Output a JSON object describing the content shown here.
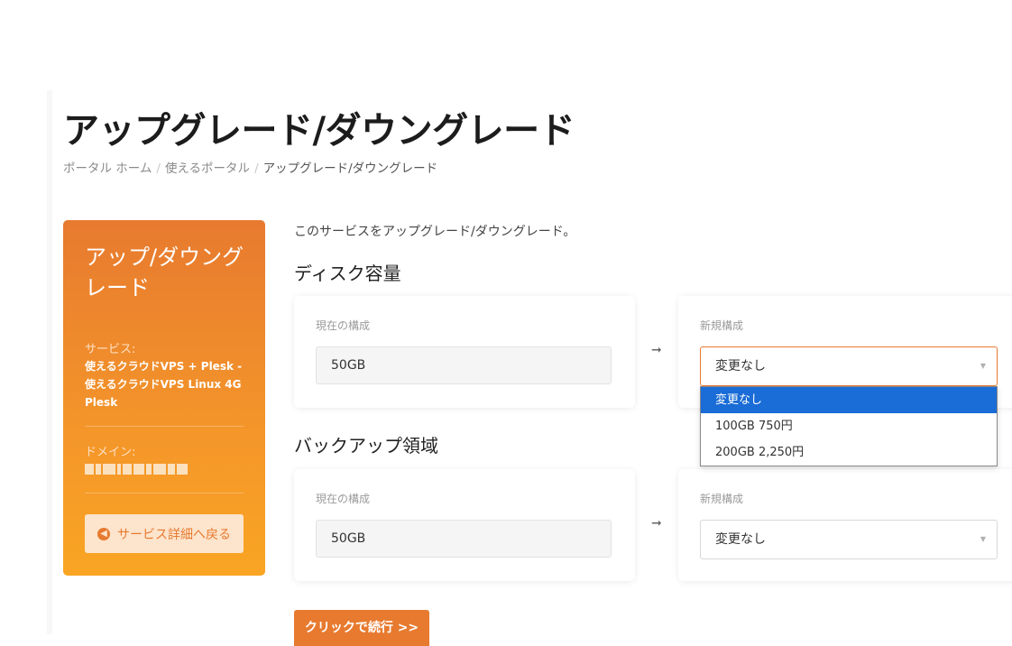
{
  "page": {
    "title": "アップグレード/ダウングレード",
    "breadcrumb": [
      "ポータル ホーム",
      "使えるポータル",
      "アップグレード/ダウングレード"
    ],
    "intro": "このサービスをアップグレード/ダウングレード。"
  },
  "sidebar": {
    "title": "アップ/ダウングレード",
    "service_label": "サービス:",
    "service_value": "使えるクラウドVPS + Plesk - 使えるクラウドVPS Linux 4G Plesk",
    "domain_label": "ドメイン:",
    "back_button": "サービス詳細へ戻る"
  },
  "sections": [
    {
      "title": "ディスク容量",
      "current_label": "現在の構成",
      "current_value": "50GB",
      "new_label": "新規構成",
      "new_value": "変更なし",
      "options": [
        "変更なし",
        "100GB 750円",
        "200GB 2,250円"
      ]
    },
    {
      "title": "バックアップ領域",
      "current_label": "現在の構成",
      "current_value": "50GB",
      "new_label": "新規構成",
      "new_value": "変更なし"
    }
  ],
  "continue_button": "クリックで続行 >>",
  "colors": {
    "accent": "#e77a2f",
    "sidebar_gradient_end": "#f9a523",
    "option_highlight": "#1a6cd6"
  }
}
